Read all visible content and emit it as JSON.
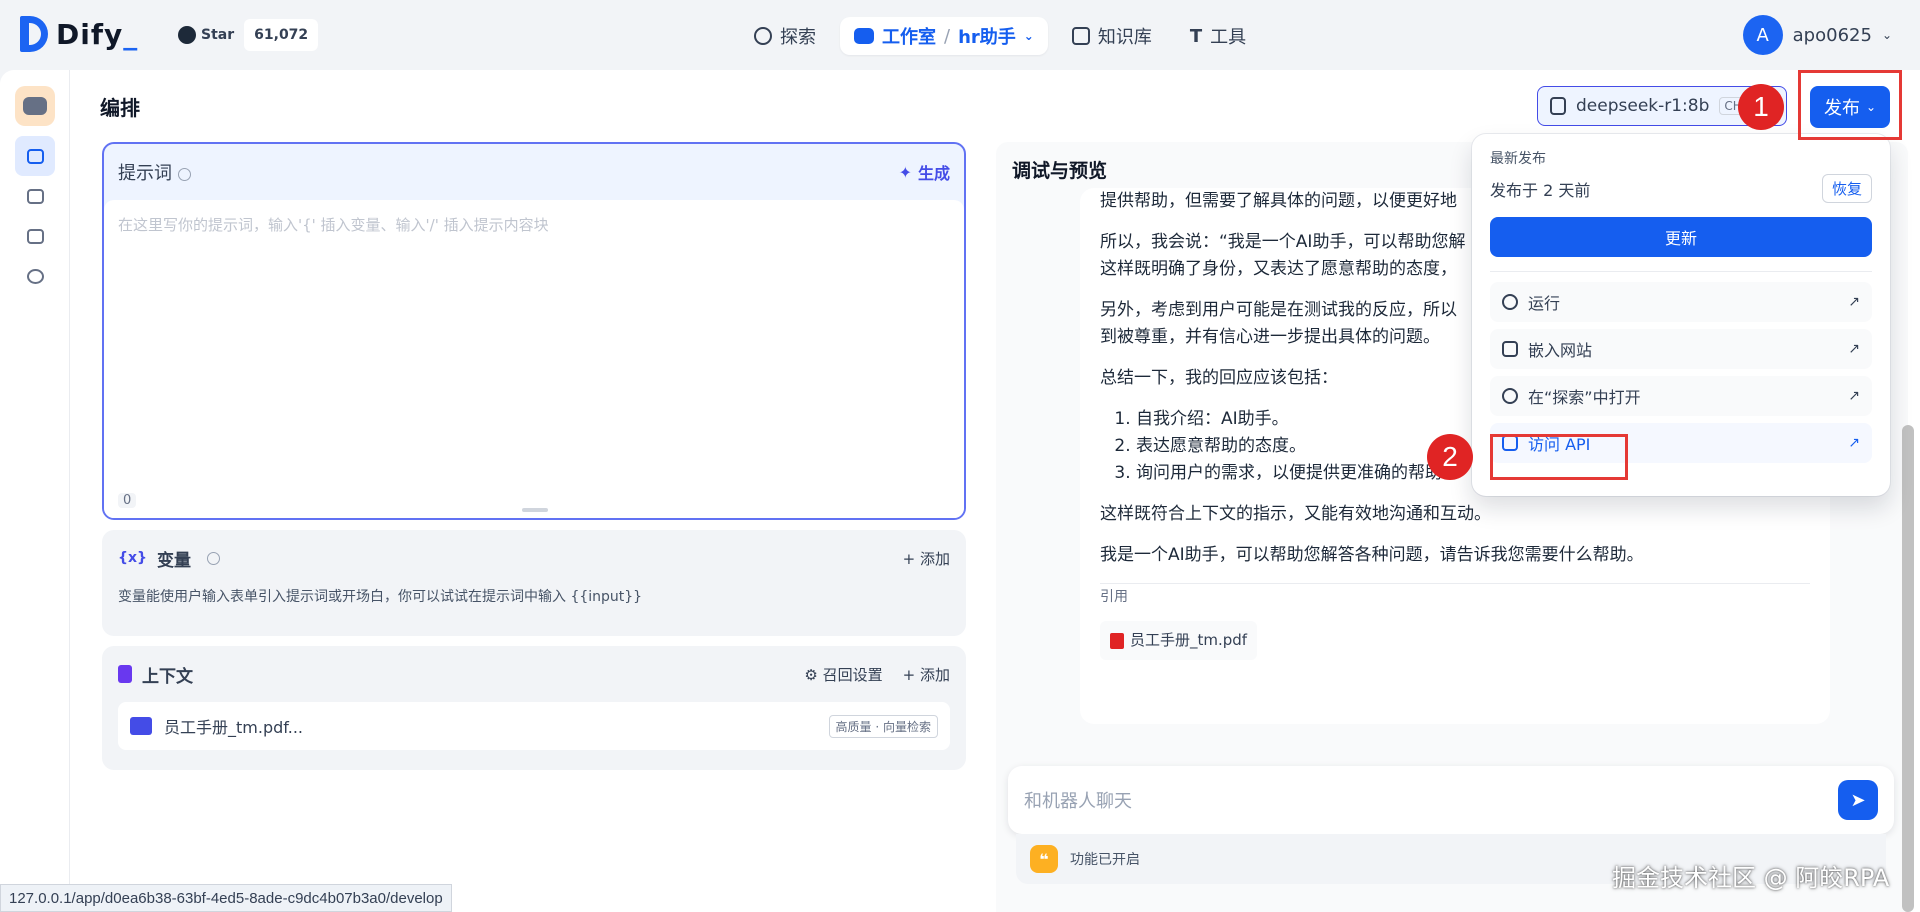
{
  "brand": {
    "name": "Dify"
  },
  "github": {
    "star_label": "Star",
    "star_count": "61,072"
  },
  "nav": {
    "explore": "探索",
    "studio": "工作室",
    "separator": "/",
    "app_name": "hr助手",
    "knowledge": "知识库",
    "tools": "工具"
  },
  "user": {
    "avatar_letter": "A",
    "name": "apo0625"
  },
  "header": {
    "title": "编排",
    "model_name": "deepseek-r1:8b",
    "model_tag": "CHA",
    "publish_label": "发布"
  },
  "annotations": {
    "step1": "1",
    "step2": "2"
  },
  "prompt": {
    "title": "提示词",
    "generate_label": "生成",
    "placeholder": "在这里写你的提示词，输入'{' 插入变量、输入'/' 插入提示内容块",
    "char_count": "0"
  },
  "variables": {
    "title": "变量",
    "add_label": "添加",
    "description": "变量能使用户输入表单引入提示词或开场白，你可以试试在提示词中输入 {{input}}"
  },
  "context": {
    "title": "上下文",
    "recall_label": "召回设置",
    "add_label": "添加",
    "item_name": "员工手册_tm.pdf...",
    "item_tag": "高质量 · 向量检索"
  },
  "debug": {
    "title": "调试与预览",
    "paragraphs": [
      "提供帮助，但需要了解具体的问题，以便更好地",
      "所以，我会说：“我是一个AI助手，可以帮助您解",
      "这样既明确了身份，又表达了愿意帮助的态度，",
      "另外，考虑到用户可能是在测试我的反应，所以",
      "到被尊重，并有信心进一步提出具体的问题。",
      "总结一下，我的回应应该包括："
    ],
    "list": [
      "自我介绍：AI助手。",
      "表达愿意帮助的态度。",
      "询问用户的需求，以便提供更准确的帮助。"
    ],
    "closing": [
      "这样既符合上下文的指示，又能有效地沟通和互动。",
      "我是一个AI助手，可以帮助您解答各种问题，请告诉我您需要什么帮助。"
    ],
    "citation_label": "引用",
    "citation_file": "员工手册_tm.pdf",
    "chat_placeholder": "和机器人聊天",
    "feature_label": "功能已开启"
  },
  "publish_menu": {
    "latest_label": "最新发布",
    "published_time": "发布于 2 天前",
    "restore_label": "恢复",
    "update_label": "更新",
    "items": [
      {
        "label": "运行",
        "icon": "play-circle-icon"
      },
      {
        "label": "嵌入网站",
        "icon": "code-window-icon"
      },
      {
        "label": "在“探索”中打开",
        "icon": "compass-icon"
      },
      {
        "label": "访问 API",
        "icon": "file-text-icon"
      }
    ]
  },
  "status_url": "127.0.0.1/app/d0ea6b38-63bf-4ed5-8ade-c9dc4b07b3a0/develop",
  "watermark": "掘金技术社区 @ 阿皎RPA",
  "colors": {
    "primary": "#155eef",
    "accent": "#444ce7",
    "annotation_red": "#e53935"
  }
}
